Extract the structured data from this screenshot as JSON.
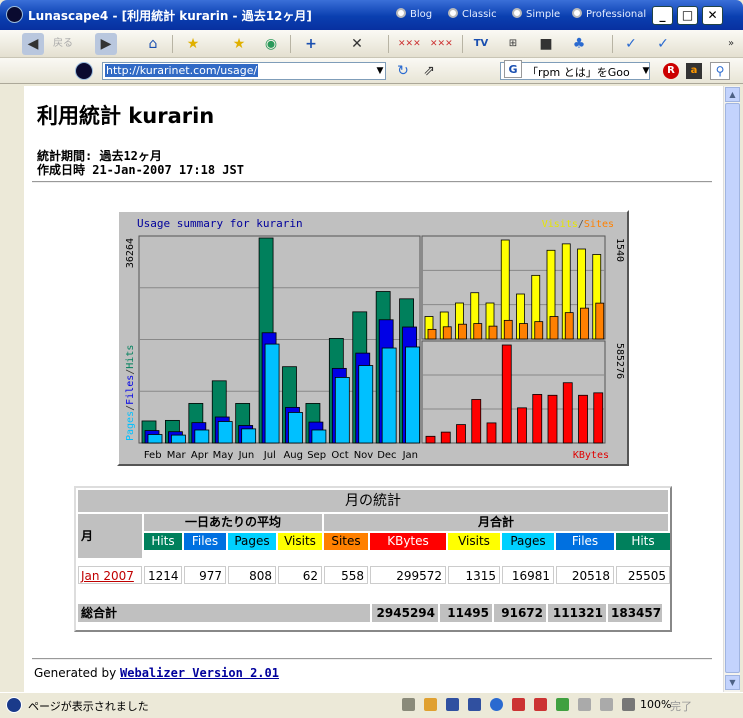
{
  "window": {
    "title": "Lunascape4 - [利用統計 kurarin - 過去12ヶ月]",
    "modes": [
      "Blog",
      "Classic",
      "Simple",
      "Professional"
    ],
    "controls": {
      "minimize": "_",
      "maximize": "□",
      "close": "✕"
    }
  },
  "toolbar": {
    "back_label": "戻る",
    "tv_label": "TV"
  },
  "address": {
    "url": "http://kurarinet.com/usage/"
  },
  "search": {
    "value": "「rpm とは」をGoo"
  },
  "page": {
    "title": "利用統計 kurarin",
    "period": "統計期間: 過去12ヶ月",
    "generated": "作成日時 21-Jan-2007 17:18 JST",
    "footer_prefix": "Generated by",
    "footer_link": "Webalizer Version 2.01"
  },
  "chart_data": {
    "type": "bar",
    "title": "Usage summary for kurarin",
    "categories": [
      "Feb",
      "Mar",
      "Apr",
      "May",
      "Jun",
      "Jul",
      "Aug",
      "Sep",
      "Oct",
      "Nov",
      "Dec",
      "Jan"
    ],
    "left_axis_max": "36264",
    "left_axis_label": {
      "pages": "Pages",
      "files": "Files",
      "hits": "Hits"
    },
    "right_top_axis_max": "1540",
    "right_bottom_axis_max": "585276",
    "right_top_legend": {
      "visits": "Visits",
      "sites": "Sites"
    },
    "right_bottom_legend": "KBytes",
    "colors": {
      "hits": "#00805c",
      "files": "#0000e6",
      "pages": "#00c0ff",
      "visits": "#ffff00",
      "sites": "#ff8000",
      "kbytes": "#ff0000"
    },
    "series": [
      {
        "name": "Hits",
        "values": [
          3900,
          4000,
          7000,
          11000,
          7000,
          36264,
          13500,
          7000,
          18500,
          23200,
          26800,
          25505
        ]
      },
      {
        "name": "Files",
        "values": [
          2200,
          2000,
          3600,
          4600,
          3100,
          19500,
          6300,
          3700,
          13200,
          15900,
          21800,
          20518
        ]
      },
      {
        "name": "Pages",
        "values": [
          1500,
          1400,
          2300,
          3800,
          2500,
          17500,
          5400,
          2300,
          11600,
          13700,
          16800,
          16981
        ]
      },
      {
        "name": "Visits",
        "values": [
          350,
          420,
          560,
          720,
          560,
          1540,
          700,
          990,
          1380,
          1480,
          1400,
          1315
        ]
      },
      {
        "name": "Sites",
        "values": [
          150,
          190,
          230,
          240,
          200,
          290,
          240,
          270,
          350,
          410,
          480,
          558
        ]
      },
      {
        "name": "KBytes",
        "values": [
          40000,
          65000,
          110000,
          260000,
          120000,
          585276,
          210000,
          290000,
          285000,
          360000,
          285000,
          299572
        ]
      }
    ]
  },
  "stats": {
    "title": "月の統計",
    "month_header": "月",
    "daily_avg_header": "一日あたりの平均",
    "monthly_total_header": "月合計",
    "daily_cols": [
      "Hits",
      "Files",
      "Pages",
      "Visits"
    ],
    "monthly_cols": [
      "Sites",
      "KBytes",
      "Visits",
      "Pages",
      "Files",
      "Hits"
    ],
    "rows": [
      {
        "month": "Jan 2007",
        "values": [
          "1214",
          "977",
          "808",
          "62",
          "558",
          "299572",
          "1315",
          "16981",
          "20518",
          "25505"
        ]
      }
    ],
    "totals_label": "総合計",
    "totals": [
      "2945294",
      "11495",
      "91672",
      "111321",
      "183457"
    ]
  },
  "statusbar": {
    "text": "ページが表示されました",
    "zoom": "100%",
    "state": "完了"
  }
}
